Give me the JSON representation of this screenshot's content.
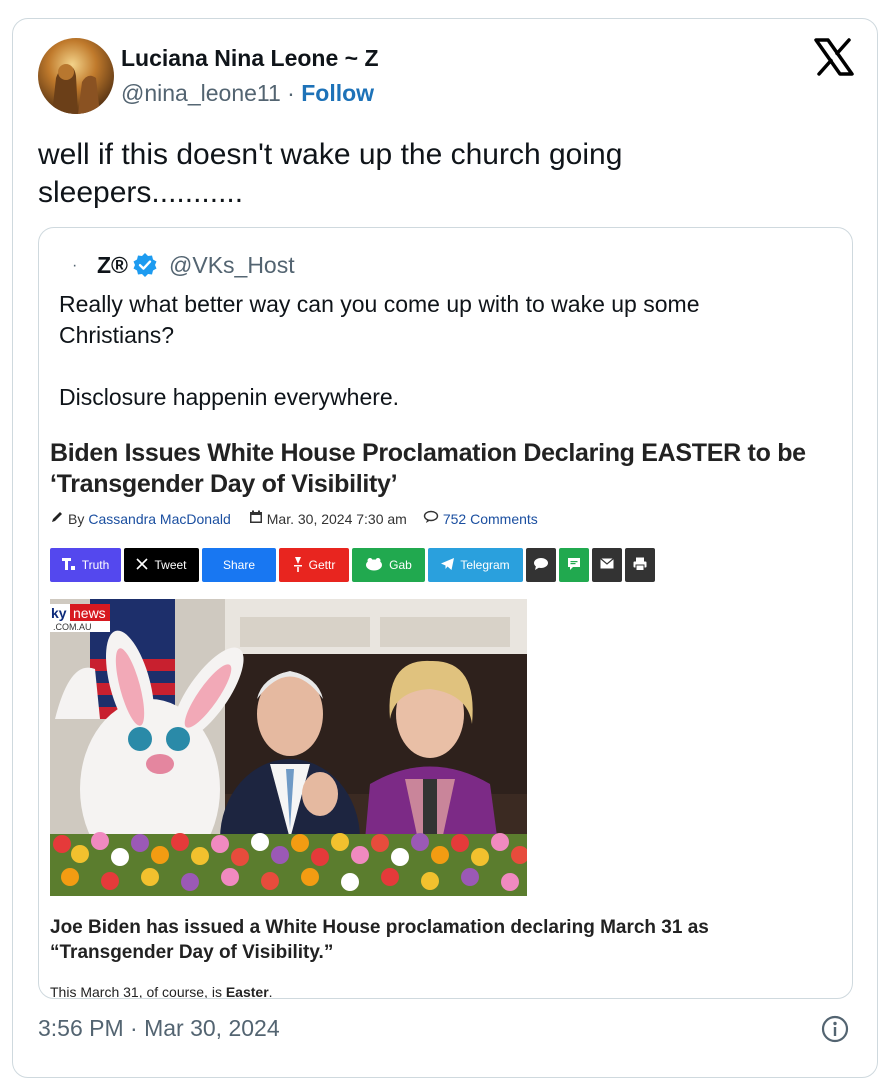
{
  "tweet": {
    "display_name": "Luciana Nina Leone ~ Z",
    "handle": "@nina_leone11",
    "separator": "·",
    "follow_label": "Follow",
    "text": "well if this doesn't wake up the church going\nsleepers...........",
    "timestamp": "3:56 PM · Mar 30, 2024"
  },
  "quote": {
    "dot": "·",
    "name": "Z®",
    "handle": "@VKs_Host",
    "text": "Really what better way can you come up with to wake up some\nChristians?\n\nDisclosure happenin everywhere.",
    "article": {
      "headline": "Biden Issues White House Proclamation Declaring EASTER to be ‘Transgender Day of Visibility’",
      "by_prefix": "By",
      "author": "Cassandra MacDonald",
      "date": "Mar. 30, 2024 7:30 am",
      "comments": "752 Comments",
      "share_buttons": [
        {
          "label": "Truth",
          "color": "#5448ee"
        },
        {
          "label": "Tweet",
          "color": "#000000"
        },
        {
          "label": "Share",
          "color": "#1877f2"
        },
        {
          "label": "Gettr",
          "color": "#e8251f"
        },
        {
          "label": "Gab",
          "color": "#21a94f"
        },
        {
          "label": "Telegram",
          "color": "#2aa0dd"
        }
      ],
      "photo_logo_top": "news",
      "photo_logo_prefix": "ky",
      "photo_logo_bottom": ".COM.AU",
      "caption": "Joe Biden has issued a White House proclamation declaring March 31 as “Transgender Day of Visibility.”",
      "body_prefix": "This March 31, of course, is ",
      "body_bold": "Easter",
      "body_suffix": "."
    }
  },
  "colors": {
    "border": "#cfd9de",
    "follow": "#1d72b8",
    "verified": "#1d9bf0",
    "secondary_text": "#536471"
  }
}
